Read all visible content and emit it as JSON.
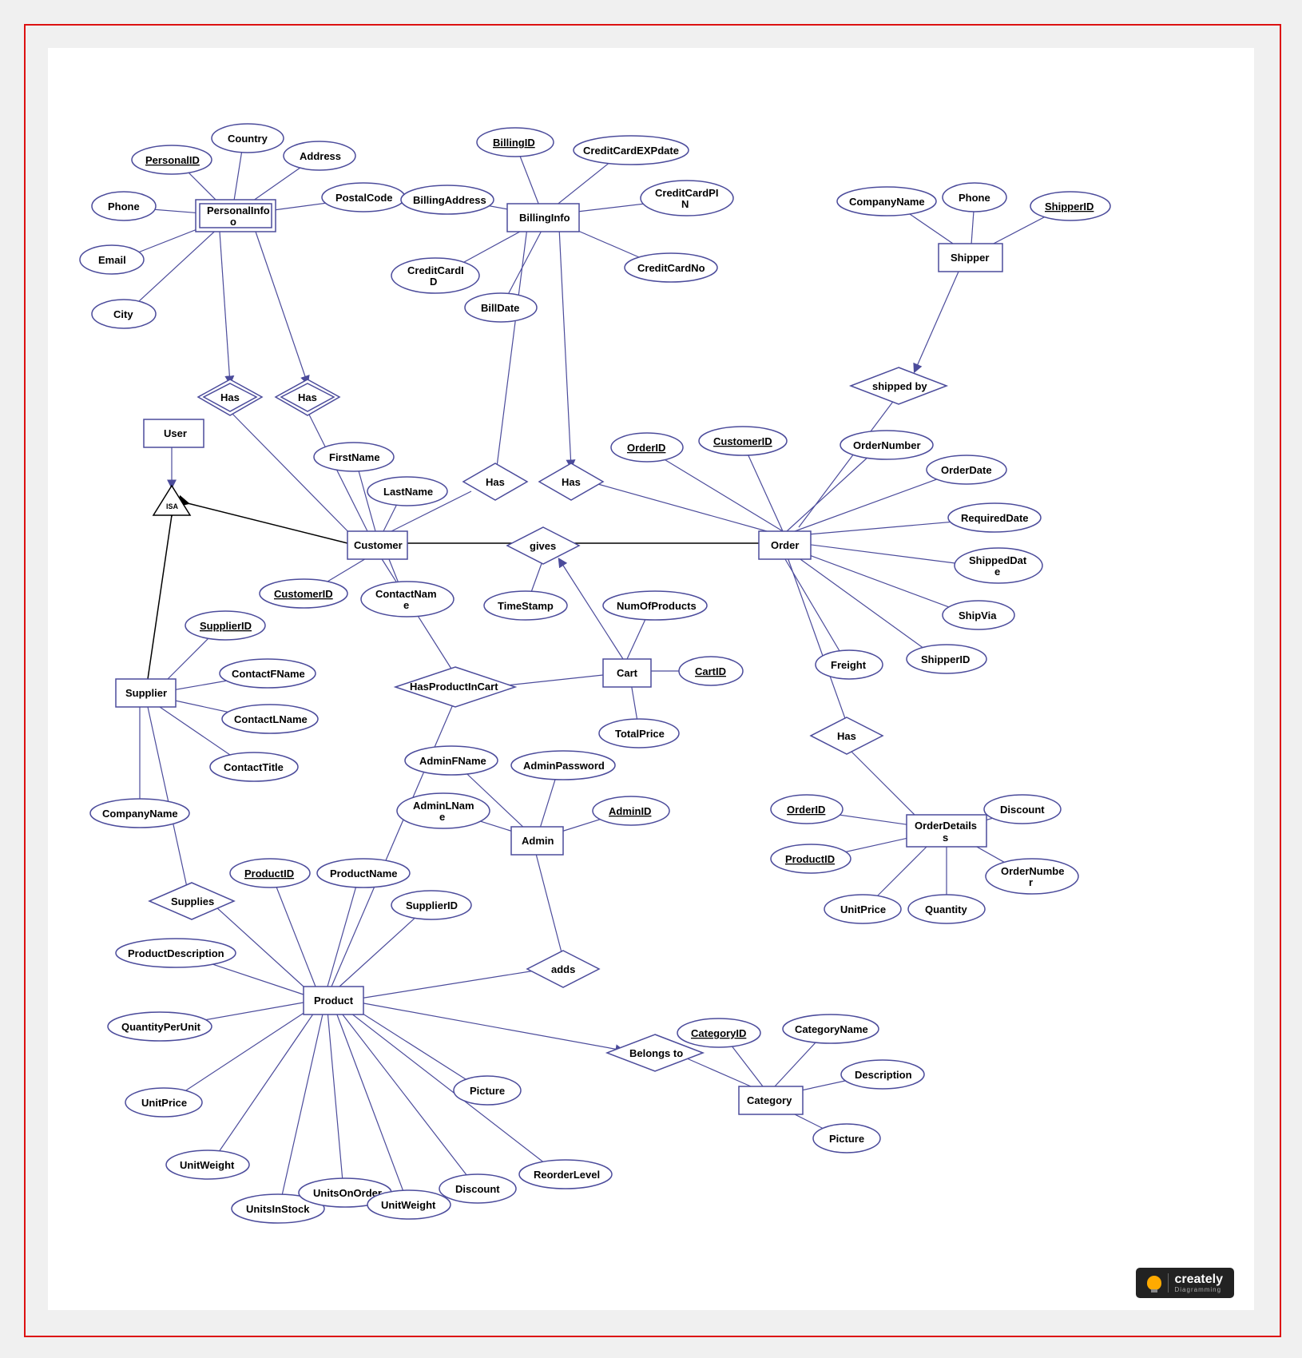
{
  "logo": {
    "main": "creately",
    "sub": "Diagramming"
  },
  "isa": "ISA",
  "entities": {
    "user": "User",
    "personalinfo": "PersonalInfo",
    "billinginfo": "BillingInfo",
    "shipper": "Shipper",
    "customer": "Customer",
    "order": "Order",
    "cart": "Cart",
    "supplier": "Supplier",
    "admin": "Admin",
    "orderdetails": "OrderDetails",
    "product": "Product",
    "category": "Category"
  },
  "rels": {
    "has1": "Has",
    "has2": "Has",
    "has3": "Has",
    "has4": "Has",
    "has5": "Has",
    "shippedby": "shipped by",
    "gives": "gives",
    "hasproductincart": "HasProductInCart",
    "supplies": "Supplies",
    "adds": "adds",
    "belongsto": "Belongs to"
  },
  "attrs": {
    "personalid": "PersonalID",
    "country": "Country",
    "address": "Address",
    "postalcode": "PostalCode",
    "phone": "Phone",
    "email": "Email",
    "city": "City",
    "billingid": "BillingID",
    "creditcardexpdate": "CreditCardEXPdate",
    "billingaddress": "BillingAddress",
    "creditcardpin": "CreditCardPIN",
    "creditcardid": "CreditCardID",
    "creditcardno": "CreditCardNo",
    "billdate": "BillDate",
    "companyname": "CompanyName",
    "phone2": "Phone",
    "shipperid": "ShipperID",
    "firstname": "FirstName",
    "lastname": "LastName",
    "customerid": "CustomerID",
    "contactname": "ContactName",
    "orderid": "OrderID",
    "customerid2": "CustomerID",
    "ordernumber": "OrderNumber",
    "orderdate": "OrderDate",
    "requireddate": "RequiredDate",
    "shippeddate": "ShippedDate",
    "shipvia": "ShipVia",
    "shipperid2": "ShipperID",
    "freight": "Freight",
    "timestamp": "TimeStamp",
    "numofproducts": "NumOfProducts",
    "cartid": "CartID",
    "totalprice": "TotalPrice",
    "supplierid": "SupplierID",
    "contactfname": "ContactFName",
    "contactlname": "ContactLName",
    "contacttitle": "ContactTitle",
    "companyname2": "CompanyName",
    "adminfname": "AdminFName",
    "adminlname": "AdminLName",
    "adminpassword": "AdminPassword",
    "adminid": "AdminID",
    "orderid2": "OrderID",
    "productid2": "ProductID",
    "discount2": "Discount",
    "ordernumber2": "OrderNumber",
    "unitprice2": "UnitPrice",
    "quantity": "Quantity",
    "productid": "ProductID",
    "productname": "ProductName",
    "supplierid2": "SupplierID",
    "productdescription": "ProductDescription",
    "quantityperunit": "QuantityPerUnit",
    "unitprice": "UnitPrice",
    "unitweight": "UnitWeight",
    "unitsinstock": "UnitsInStock",
    "unitsonorder": "UnitsOnOrder",
    "unitweight2": "UnitWeight",
    "discount": "Discount",
    "reorderlevel": "ReorderLevel",
    "picture": "Picture",
    "categoryid": "CategoryID",
    "categoryname": "CategoryName",
    "description": "Description",
    "picture2": "Picture"
  }
}
